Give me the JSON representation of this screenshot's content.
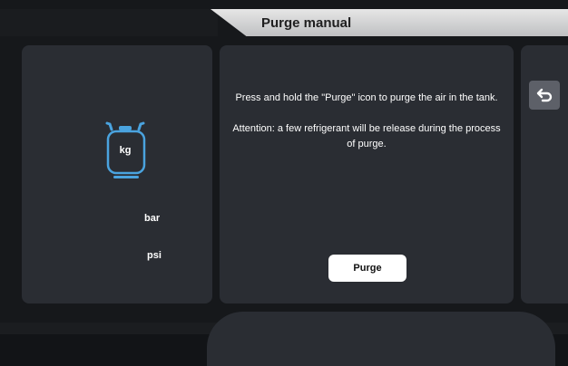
{
  "header": {
    "title": "Purge manual"
  },
  "left_panel": {
    "tank_unit": "kg",
    "pressure_units": [
      "bar",
      "psi"
    ]
  },
  "center_panel": {
    "instruction_1": "Press and hold the  \"Purge\"  icon to purge the air in the tank.",
    "instruction_2": "Attention: a few refrigerant will be release during the process of purge.",
    "purge_label": "Purge"
  },
  "right_panel": {
    "back_icon": "return-arrow-icon"
  },
  "colors": {
    "background": "#16181b",
    "panel": "#2a2d33",
    "accent_tank": "#4aa3df",
    "title_tab": "#d6d6d6",
    "button": "#ffffff"
  }
}
